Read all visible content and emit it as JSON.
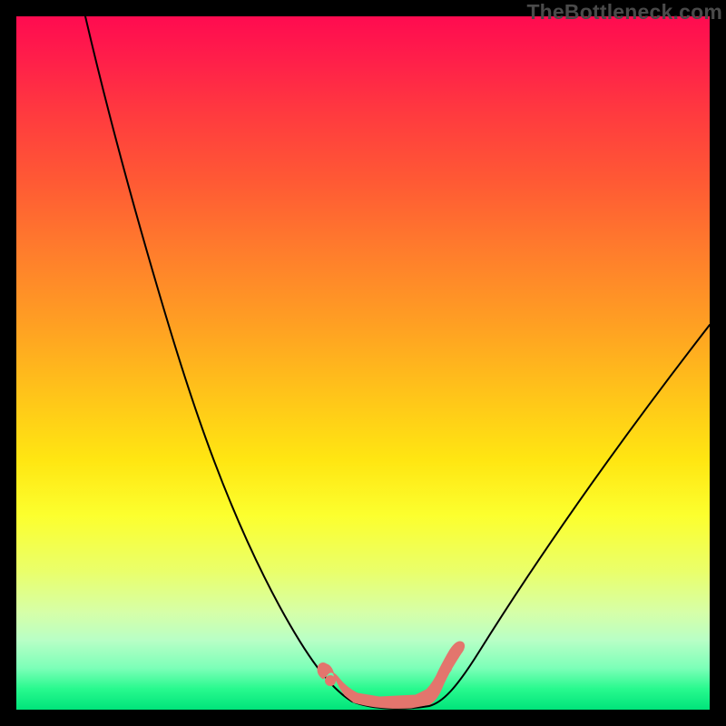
{
  "watermark": "TheBottleneck.com",
  "colors": {
    "gradient_top": "#ff0b50",
    "gradient_bottom": "#00e47a",
    "curve": "#000000",
    "accent": "#e3756d",
    "frame": "#000000"
  },
  "chart_data": {
    "type": "line",
    "title": "",
    "xlabel": "",
    "ylabel": "",
    "xlim": [
      0,
      100
    ],
    "ylim": [
      0,
      100
    ],
    "grid": false,
    "legend": false,
    "series": [
      {
        "name": "bottleneck-curve",
        "x": [
          10,
          14,
          18,
          22,
          26,
          30,
          34,
          38,
          42,
          44,
          46,
          48,
          50,
          52,
          54,
          56,
          58,
          60,
          64,
          70,
          76,
          82,
          88,
          94,
          100
        ],
        "y": [
          100,
          89,
          78,
          68,
          58,
          49,
          40,
          32,
          24,
          20,
          15,
          10,
          6,
          3,
          1,
          0,
          0,
          0.5,
          2,
          8,
          17,
          27,
          38,
          50,
          62
        ]
      }
    ],
    "highlight_region": {
      "name": "optimal-zone",
      "x_range": [
        44,
        60
      ],
      "y_range": [
        0,
        4
      ]
    },
    "annotations": []
  }
}
